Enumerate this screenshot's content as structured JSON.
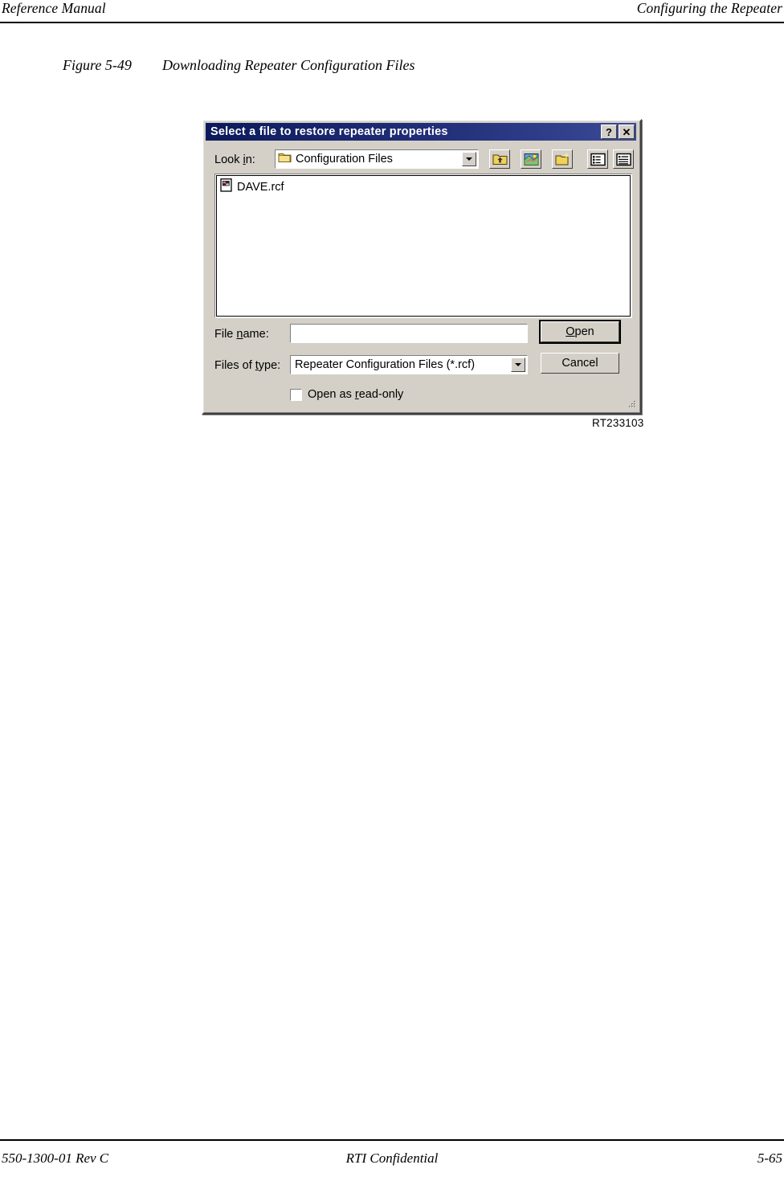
{
  "page": {
    "header_left": "Reference Manual",
    "header_right": "Configuring the Repeater",
    "footer_left": "550-1300-01 Rev C",
    "footer_center": "RTI Confidential",
    "footer_right": "5-65"
  },
  "figure": {
    "number": "Figure 5-49",
    "title": "Downloading Repeater Configuration Files",
    "id": "RT233103"
  },
  "dialog": {
    "title": "Select a file to restore repeater properties",
    "help_button": "?",
    "close_button": "✕",
    "lookin": {
      "label_pre": "Look ",
      "label_accel": "i",
      "label_post": "n:",
      "value": "Configuration Files"
    },
    "toolbar": [
      {
        "name": "up-one-level-icon",
        "tooltip": "Up One Level"
      },
      {
        "name": "desktop-icon",
        "tooltip": "Desktop"
      },
      {
        "name": "new-folder-icon",
        "tooltip": "Create New Folder"
      },
      {
        "name": "list-view-icon",
        "tooltip": "List"
      },
      {
        "name": "details-view-icon",
        "tooltip": "Details"
      }
    ],
    "files": [
      {
        "name": "DAVE.rcf",
        "icon": "file-icon"
      }
    ],
    "filename": {
      "label_pre": "File ",
      "label_accel": "n",
      "label_post": "ame:",
      "value": "",
      "placeholder": ""
    },
    "filetype": {
      "label_pre": "Files of ",
      "label_accel": "t",
      "label_post": "ype:",
      "value": "Repeater Configuration Files (*.rcf)",
      "options": [
        "Repeater Configuration Files (*.rcf)"
      ]
    },
    "readonly": {
      "label_pre": "Open as ",
      "label_accel": "r",
      "label_post": "ead-only",
      "checked": false
    },
    "buttons": {
      "open_pre": "",
      "open_accel": "O",
      "open_post": "pen",
      "cancel": "Cancel"
    },
    "colors": {
      "titlebar": "#1a2a6e",
      "face": "#d4d0c8",
      "folder": "#ffe08a"
    }
  }
}
